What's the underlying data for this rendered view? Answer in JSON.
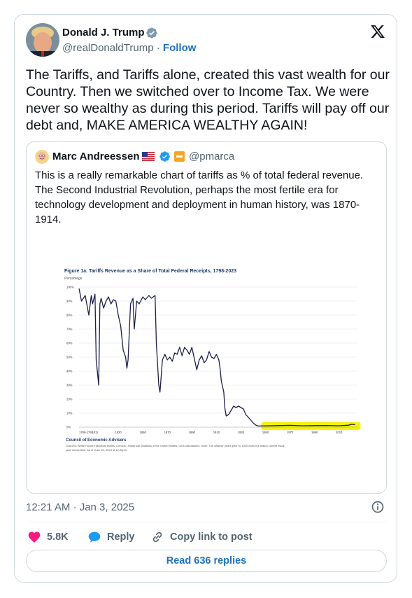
{
  "author": {
    "name": "Donald J. Trump",
    "handle": "@realDonaldTrump",
    "separator": "·",
    "follow_label": "Follow"
  },
  "tweet": {
    "text": "The Tariffs, and Tariffs alone, created this vast wealth for our Country. Then we switched over to Income Tax. We were never so wealthy as during this period. Tariffs will pay off our debt and, MAKE AMERICA WEALTHY AGAIN!",
    "timestamp": "12:21 AM · Jan 3, 2025"
  },
  "quote": {
    "name": "Marc Andreessen",
    "handle": "@pmarca",
    "text": "This is a really remarkable chart of tariffs as % of total federal revenue. The Second Industrial Revolution, perhaps the most fertile era for technology development and deployment in human history, was 1870-1914."
  },
  "chart_data": {
    "type": "line",
    "title": "Figure 1a. Tariffs Revenue as a Share of Total Federal Receipts, 1798-2023",
    "ylabel": "Percentage",
    "ylim": [
      0,
      100
    ],
    "yticks": [
      "100%",
      "90%",
      "80%",
      "70%",
      "60%",
      "50%",
      "40%",
      "30%",
      "20%",
      "10%",
      "0%"
    ],
    "xticks": [
      "1798-1791",
      "1811",
      "1830",
      "1850",
      "1870",
      "1890",
      "1910",
      "1930",
      "1950",
      "1970",
      "1990",
      "2010"
    ],
    "grid": true,
    "highlight_color": "#f4f20a",
    "line_color": "#1a1f4e",
    "x": [
      1798,
      1800,
      1803,
      1806,
      1808,
      1809,
      1811,
      1812,
      1814,
      1815,
      1816,
      1818,
      1820,
      1822,
      1824,
      1826,
      1828,
      1830,
      1832,
      1834,
      1836,
      1837,
      1838,
      1840,
      1842,
      1843,
      1845,
      1847,
      1850,
      1852,
      1855,
      1857,
      1860,
      1861,
      1863,
      1864,
      1866,
      1868,
      1870,
      1872,
      1874,
      1876,
      1878,
      1880,
      1882,
      1884,
      1886,
      1888,
      1890,
      1892,
      1894,
      1896,
      1898,
      1900,
      1902,
      1904,
      1906,
      1908,
      1910,
      1912,
      1913,
      1914,
      1916,
      1917,
      1918,
      1920,
      1922,
      1924,
      1926,
      1928,
      1930,
      1932,
      1934,
      1936,
      1938,
      1940,
      1942,
      1944,
      1950,
      1960,
      1970,
      1980,
      1990,
      2000,
      2010,
      2018,
      2020,
      2023
    ],
    "values": [
      99,
      90,
      94,
      80,
      94,
      88,
      95,
      48,
      30,
      88,
      92,
      85,
      90,
      93,
      88,
      91,
      90,
      80,
      72,
      55,
      50,
      42,
      48,
      88,
      92,
      70,
      90,
      88,
      93,
      91,
      94,
      92,
      94,
      60,
      30,
      25,
      48,
      52,
      48,
      50,
      47,
      53,
      52,
      57,
      51,
      57,
      55,
      52,
      57,
      49,
      41,
      48,
      51,
      46,
      48,
      54,
      50,
      49,
      52,
      48,
      42,
      33,
      25,
      13,
      8,
      9,
      12,
      15,
      14,
      15,
      14,
      13,
      9,
      7,
      5,
      3,
      1.5,
      0.8,
      0.9,
      1.1,
      1.3,
      1.0,
      1.1,
      1.2,
      1.0,
      1.4,
      2.0,
      1.8
    ],
    "source_title": "Council of Economic Advisers",
    "notes": "Sources: White House Historical Tables; Census - Historical Statistics of the United States; CEA calculations. Note: The data for years prior to 1940 does not match current fiscal year convention. As of June 20, 2024 at 12:00pm."
  },
  "actions": {
    "likes": "5.8K",
    "reply_label": "Reply",
    "copy_label": "Copy link to post",
    "read_replies_label": "Read 636 replies"
  },
  "colors": {
    "link": "#1d72c4",
    "verified_grey": "#829aab",
    "verified_blue": "#1d9bf0",
    "heart": "#f91880"
  }
}
